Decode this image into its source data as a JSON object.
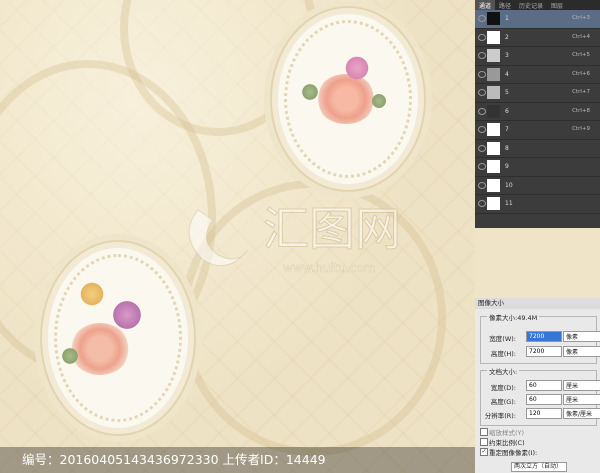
{
  "footer": {
    "text": "编号：20160405143436972330 上传者ID：14449"
  },
  "watermark": {
    "cn": "汇图网",
    "en": "www.huitu.com"
  },
  "channels_panel": {
    "tabs": [
      "通道",
      "路径",
      "历史记录",
      "图层"
    ],
    "rows": [
      {
        "name": "1",
        "shortcut": "Ctrl+3"
      },
      {
        "name": "2",
        "shortcut": "Ctrl+4"
      },
      {
        "name": "3",
        "shortcut": "Ctrl+5"
      },
      {
        "name": "4",
        "shortcut": "Ctrl+6"
      },
      {
        "name": "5",
        "shortcut": "Ctrl+7"
      },
      {
        "name": "6",
        "shortcut": "Ctrl+8"
      },
      {
        "name": "7",
        "shortcut": "Ctrl+9"
      },
      {
        "name": "8",
        "shortcut": ""
      },
      {
        "name": "9",
        "shortcut": ""
      },
      {
        "name": "10",
        "shortcut": ""
      },
      {
        "name": "11",
        "shortcut": ""
      }
    ]
  },
  "image_size": {
    "title": "图像大小",
    "pixel_dimensions": "像素大小:49.4M",
    "width_label": "宽度(W):",
    "width_value": "7200",
    "width_unit": "像素",
    "height_label": "高度(H):",
    "height_value": "7200",
    "height_unit": "像素",
    "doc_size": "文档大小:",
    "doc_width_label": "宽度(D):",
    "doc_width_value": "60",
    "doc_width_unit": "厘米",
    "doc_height_label": "高度(G):",
    "doc_height_value": "60",
    "doc_height_unit": "厘米",
    "resolution_label": "分辨率(R):",
    "resolution_value": "120",
    "resolution_unit": "像素/厘米",
    "scale_styles": "缩放样式(Y)",
    "constrain": "约束比例(C)",
    "resample": "重定图像像素(I):",
    "resample_method": "两次立方（自动）"
  }
}
